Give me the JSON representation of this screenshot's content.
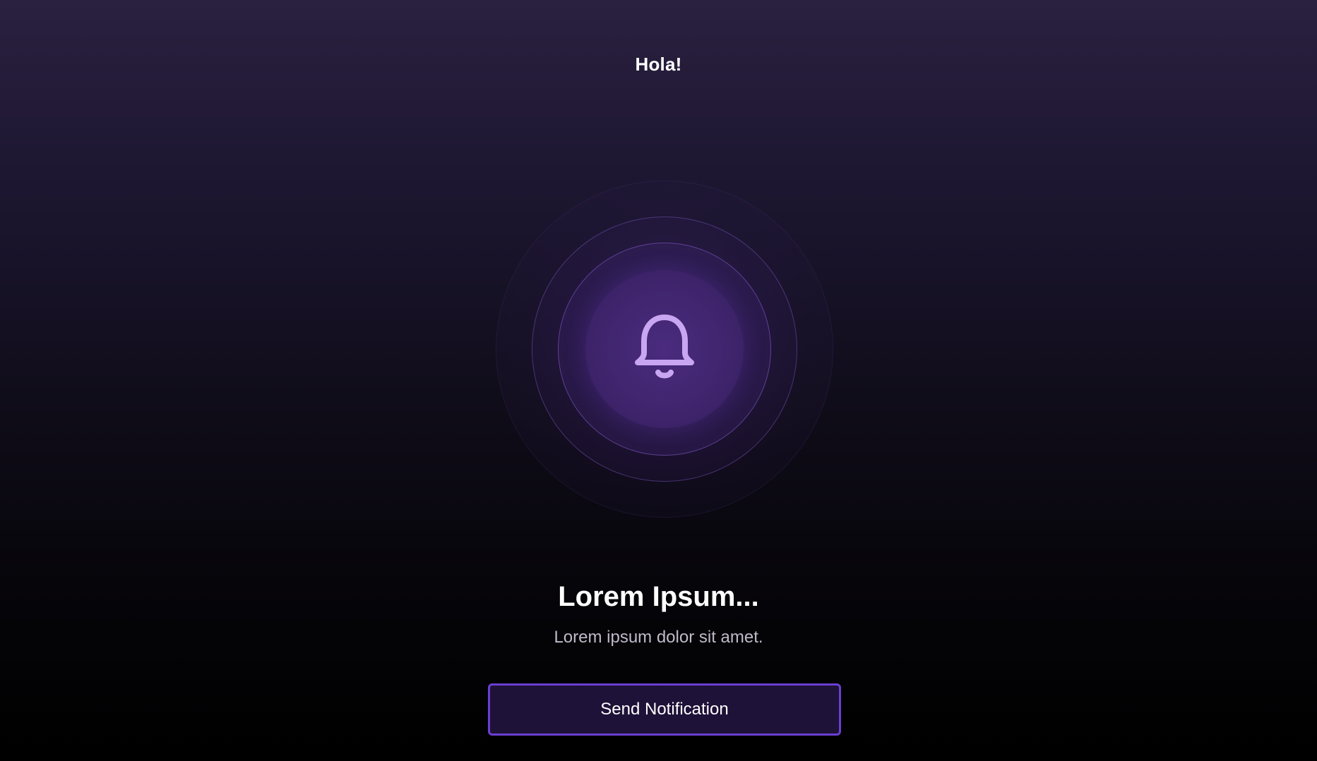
{
  "header": {
    "greeting": "Hola!"
  },
  "hero": {
    "icon": "bell-icon",
    "accent_color": "#c9a6f2",
    "title": "Lorem Ipsum...",
    "subtitle": "Lorem ipsum dolor sit amet."
  },
  "actions": {
    "send_label": "Send Notification",
    "button_border_color": "#6a3fd1",
    "button_background": "#1f1238"
  }
}
